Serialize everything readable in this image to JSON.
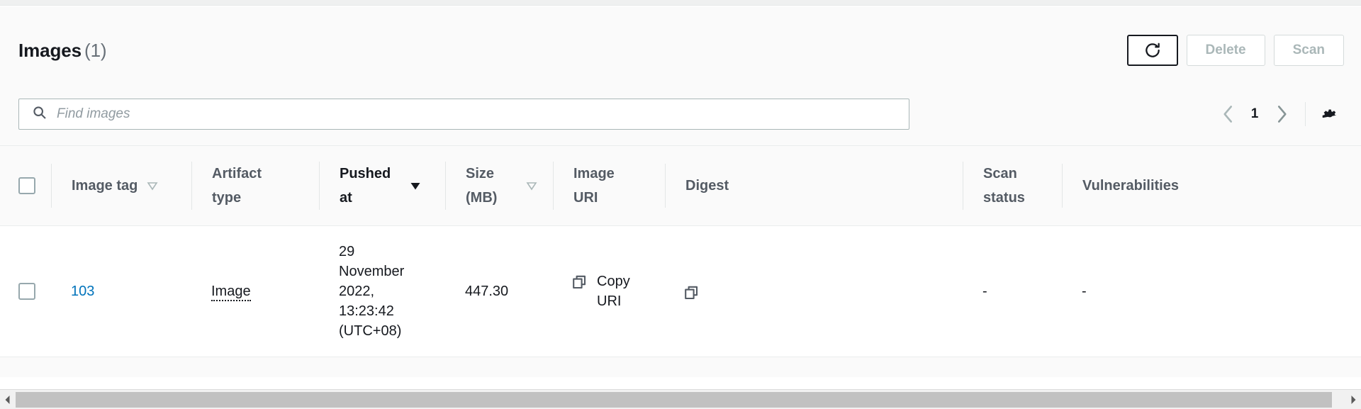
{
  "panel": {
    "title_main": "Images",
    "title_count": "(1)"
  },
  "toolbar": {
    "refresh_icon": "refresh-icon",
    "delete_label": "Delete",
    "scan_label": "Scan"
  },
  "search": {
    "icon": "search-icon",
    "placeholder": "Find images",
    "value": ""
  },
  "pagination": {
    "prev_icon": "chevron-left-icon",
    "page_number": "1",
    "next_icon": "chevron-right-icon",
    "settings_icon": "gear-icon"
  },
  "table": {
    "columns": [
      {
        "key": "select",
        "label": "",
        "sort": "none"
      },
      {
        "key": "image_tag",
        "label": "Image tag",
        "sort": "inactive"
      },
      {
        "key": "artifact_type",
        "label": "Artifact type",
        "sort": "none"
      },
      {
        "key": "pushed_at",
        "label": "Pushed at",
        "sort": "active-desc"
      },
      {
        "key": "size_mb",
        "label": "Size (MB)",
        "sort": "inactive"
      },
      {
        "key": "image_uri",
        "label": "Image URI",
        "sort": "none"
      },
      {
        "key": "digest",
        "label": "Digest",
        "sort": "none"
      },
      {
        "key": "scan_status",
        "label": "Scan status",
        "sort": "none"
      },
      {
        "key": "vulnerabilities",
        "label": "Vulnerabilities",
        "sort": "none"
      }
    ],
    "rows": [
      {
        "image_tag": "103",
        "artifact_type": "Image",
        "pushed_at": "29 November 2022, 13:23:42 (UTC+08)",
        "size_mb": "447.30",
        "image_uri_label": "Copy URI",
        "image_uri_icon": "copy-icon",
        "digest_label": "",
        "digest_icon": "copy-icon",
        "scan_status": "-",
        "vulnerabilities": "-"
      }
    ]
  },
  "scrollbar": {
    "left_arrow_icon": "scroll-left-arrow-icon",
    "right_arrow_icon": "scroll-right-arrow-icon"
  },
  "colors": {
    "link": "#0073bb",
    "panel_bg": "#fafafa",
    "header_text": "#545b64",
    "active_sort_text": "#16191f",
    "disabled_text": "#aab7b8"
  }
}
